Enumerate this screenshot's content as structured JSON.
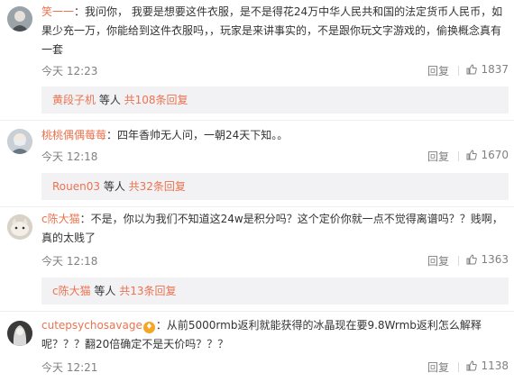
{
  "reply_label": "回复",
  "comments": [
    {
      "user": "笑一一",
      "text": "：我问你， 我要是想要这件衣服，是不是得花24万中华人民共和国的法定货币人民币，如果少充一万，你能给到这件衣服吗，，玩家是来讲事实的，不是跟你玩文字游戏的，偷换概念真有一套",
      "time": "今天 12:23",
      "likes": "1837",
      "reply_box": {
        "name": "黄段子机",
        "mid": " 等人 ",
        "count": "共108条回复"
      }
    },
    {
      "user": "桃桃偶偶莓莓",
      "text": "：四年香帅无人问，一朝24天下知。。",
      "time": "今天 12:18",
      "likes": "1670",
      "reply_box": {
        "name": "Rouen03",
        "mid": " 等人 ",
        "count": "共32条回复"
      }
    },
    {
      "user": "c陈大猫",
      "text": "：不是，你以为我们不知道这24w是积分吗？这个定价你就一点不觉得离谱吗？？贱啊，真的太贱了",
      "time": "今天 12:18",
      "likes": "1363",
      "reply_box": {
        "name": "c陈大猫",
        "mid": " 等人 ",
        "count": "共13条回复"
      }
    },
    {
      "user": "cutepsychosavage",
      "badge": "♦",
      "text": "：从前5000rmb返利就能获得的冰晶现在要9.8Wrmb返利怎么解释呢？？？翻20倍确定不是天价吗？？？",
      "time": "今天 12:21",
      "likes": "1138"
    }
  ]
}
